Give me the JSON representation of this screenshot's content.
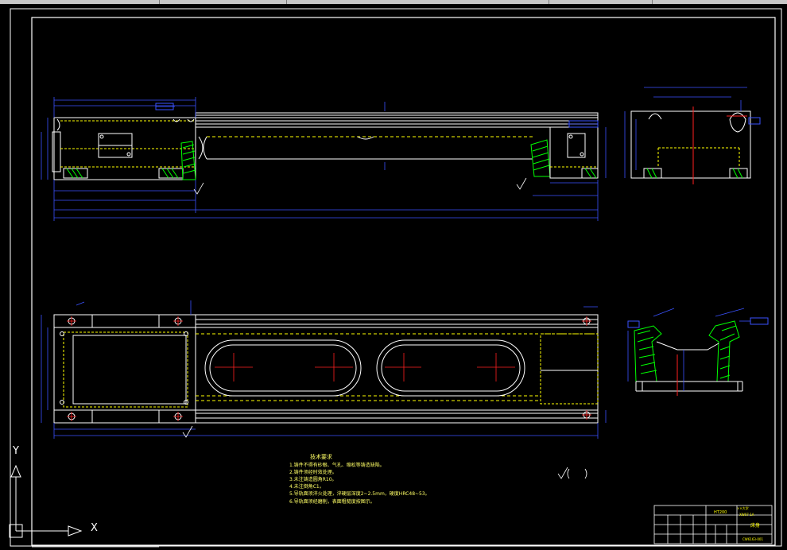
{
  "technical_notes": {
    "title": "技术要求",
    "lines": [
      "1.铸件不得有砂眼、气孔、缩松等铸造缺陷。",
      "2.铸件须经时效处理。",
      "3.未注铸造圆角R10。",
      "4.未注倒角C1。",
      "5.导轨面须淬火处理，淬硬层深度2~2.5mm，硬度HRC48~53。",
      "6.导轨面须经磨削，表面粗糙度按图示。"
    ]
  },
  "title_block": {
    "material": "HT200",
    "school": "××大学",
    "code": "XW07-1A",
    "part_name": "床身",
    "drawing_no": "CW6163-001"
  },
  "ucs": {
    "y_label": "Y",
    "x_label": "X"
  },
  "colors": {
    "background": "#000000",
    "geometry": "#ffffff",
    "dimension": "#3a52ff",
    "hidden": "#ffff00",
    "section_hatch": "#00ff00",
    "center": "#ff2020",
    "notes": "#ffff66"
  }
}
